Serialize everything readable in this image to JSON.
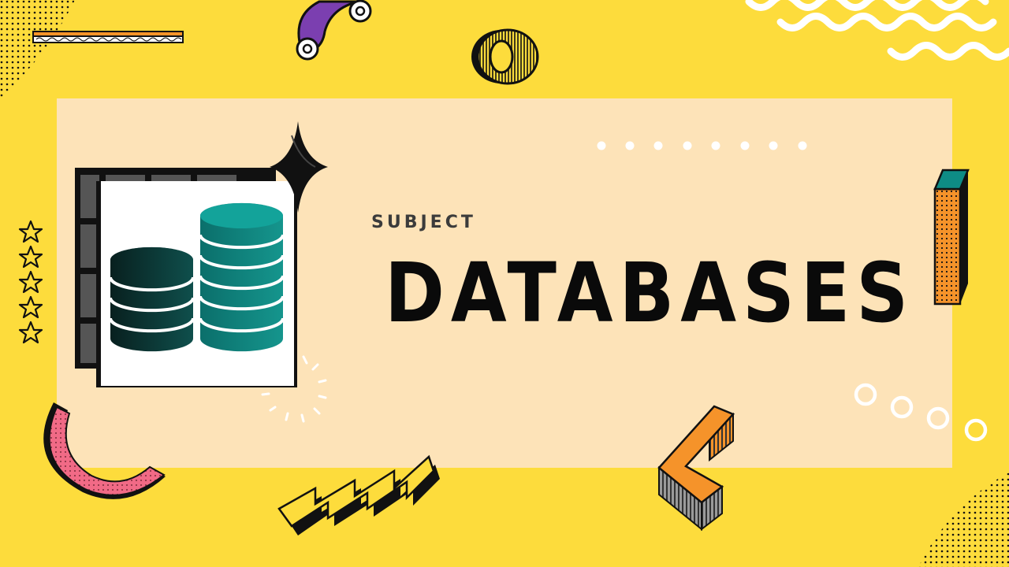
{
  "slide": {
    "eyebrow": "SUBJECT",
    "title": "DATABASES"
  },
  "colors": {
    "background": "#FDDC3C",
    "card": "#FDE3B8",
    "teal": "#0E8C85",
    "orange": "#F5932A",
    "purple": "#7B3FB0",
    "pink": "#F16A86",
    "ink": "#0a0a0a"
  },
  "icons": [
    "database-icon",
    "sparkle-icon",
    "star-icon",
    "zigzag-decoration",
    "chevron-decoration",
    "ring-decoration",
    "wave-decoration",
    "pillar-decoration",
    "circle-decoration",
    "arc-decoration"
  ]
}
